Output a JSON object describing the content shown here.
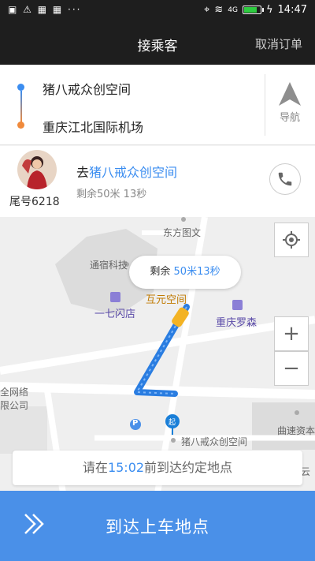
{
  "status_bar": {
    "left_icons": "▣ ⚠ ▦ ▦ ···",
    "network": "4G",
    "time": "14:47"
  },
  "header": {
    "title": "接乘客",
    "cancel": "取消订单"
  },
  "route": {
    "start": "猪八戒众创空间",
    "end": "重庆江北国际机场",
    "navigate_label": "导航"
  },
  "driver": {
    "tail_number": "尾号6218",
    "dest_prefix": "去",
    "dest_name": "猪八戒众创空间",
    "remaining": "剩余50米 13秒"
  },
  "map": {
    "pois": {
      "dongfang": "东方图文",
      "tongsu": "通宿科技",
      "qiqi": "一七闪店",
      "huyuan": "互元空间",
      "luosen": "重庆罗森",
      "network": "全网络",
      "network2": "限公司",
      "qusu": "曲速资本",
      "zbj": "猪八戒众创空间",
      "yun": "云",
      "start_marker": "起",
      "parking": "P"
    },
    "bubble_prefix": "剩余",
    "bubble_value": "50米13秒",
    "notice_prefix": "请在",
    "notice_time": "15:02",
    "notice_suffix": "前到达约定地点"
  },
  "action": {
    "label": "到达上车地点"
  },
  "colors": {
    "accent": "#3b8df0",
    "action_bg": "#4a90e8",
    "route_line": "#2a7de1"
  }
}
